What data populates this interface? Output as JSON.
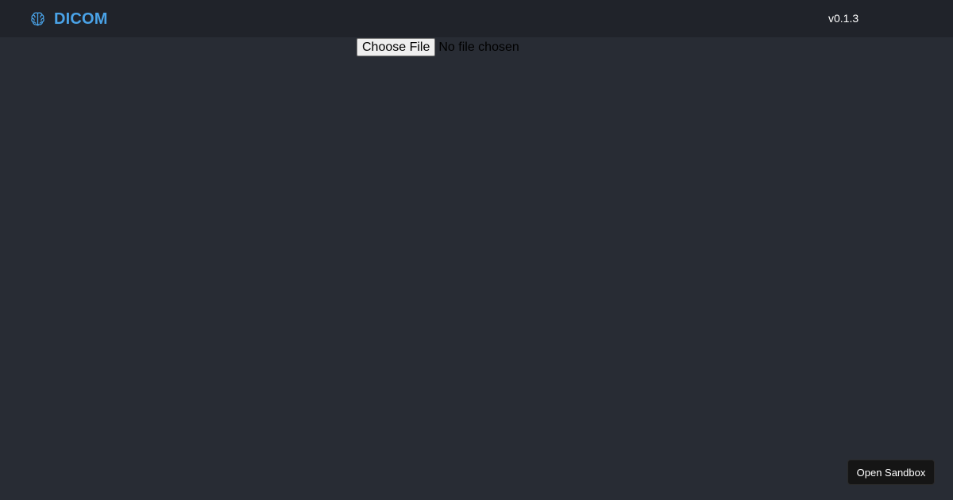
{
  "header": {
    "brand_icon": "brain-icon",
    "brand_name": "DICOM",
    "version": "v0.1.3"
  },
  "file_picker": {
    "button_label": "Choose File",
    "status": "No file chosen"
  },
  "sandbox": {
    "label": "Open Sandbox"
  },
  "colors": {
    "background": "#282c34",
    "header_background": "#20232a",
    "brand_accent": "#4aa3e8",
    "sandbox_button": "#151515"
  }
}
